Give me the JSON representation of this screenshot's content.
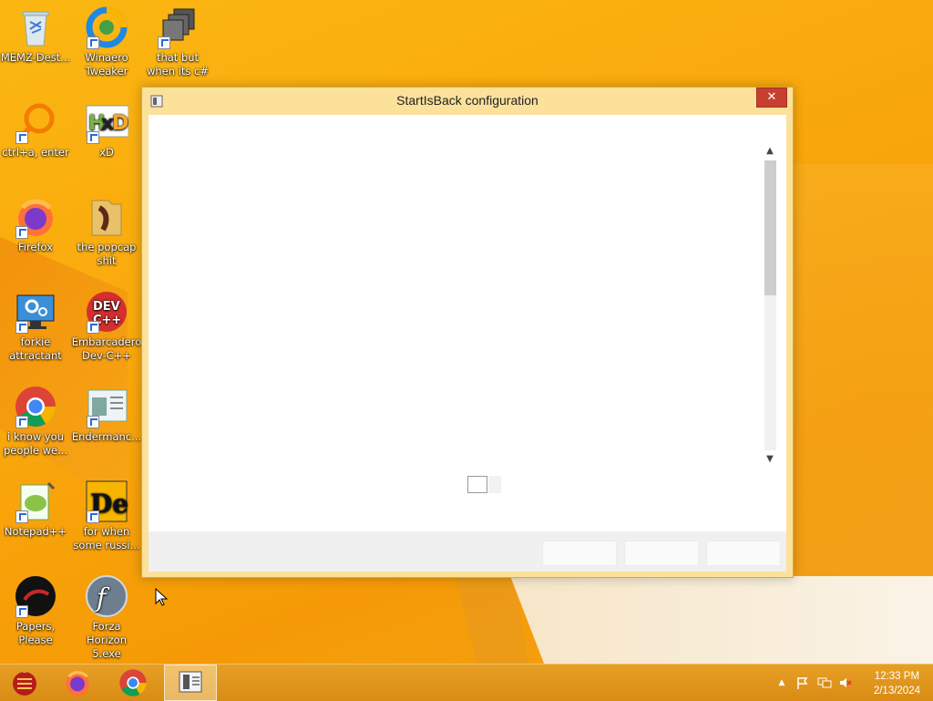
{
  "desktop": {
    "icons": [
      {
        "label": "MEMZ-Dest...",
        "icon": "recycle-bin-icon"
      },
      {
        "label": "Winaero Tweaker",
        "icon": "winaero-icon"
      },
      {
        "label": "that but when its c#",
        "icon": "stacked-windows-icon"
      },
      {
        "label": "ctrl+a, enter",
        "icon": "magnifier-orange-icon"
      },
      {
        "label": "xD",
        "icon": "hxd-icon"
      },
      {
        "label": "Firefox",
        "icon": "firefox-icon"
      },
      {
        "label": "the popcap shit",
        "icon": "folder-icon"
      },
      {
        "label": "forkie attractant",
        "icon": "monitor-gear-icon"
      },
      {
        "label": "Embarcadero Dev-C++",
        "icon": "devcpp-icon"
      },
      {
        "label": "i know you people we...",
        "icon": "chrome-icon"
      },
      {
        "label": "Endermanc...",
        "icon": "app-window-icon"
      },
      {
        "label": "Notepad++",
        "icon": "notepadpp-icon"
      },
      {
        "label": "for when some russi...",
        "icon": "de-icon"
      },
      {
        "label": "Papers, Please",
        "icon": "papers-please-icon"
      },
      {
        "label": "Forza Horizon 5.exe",
        "icon": "flash-icon"
      }
    ]
  },
  "window": {
    "title": "StartIsBack configuration",
    "close_label": "✕",
    "buttons": [
      "",
      "",
      ""
    ]
  },
  "taskbar": {
    "items": [
      "start-orb-icon",
      "firefox-icon",
      "chrome-icon",
      "startisback-icon"
    ],
    "clock_time": "12:33 PM",
    "clock_date": "2/13/2024"
  }
}
